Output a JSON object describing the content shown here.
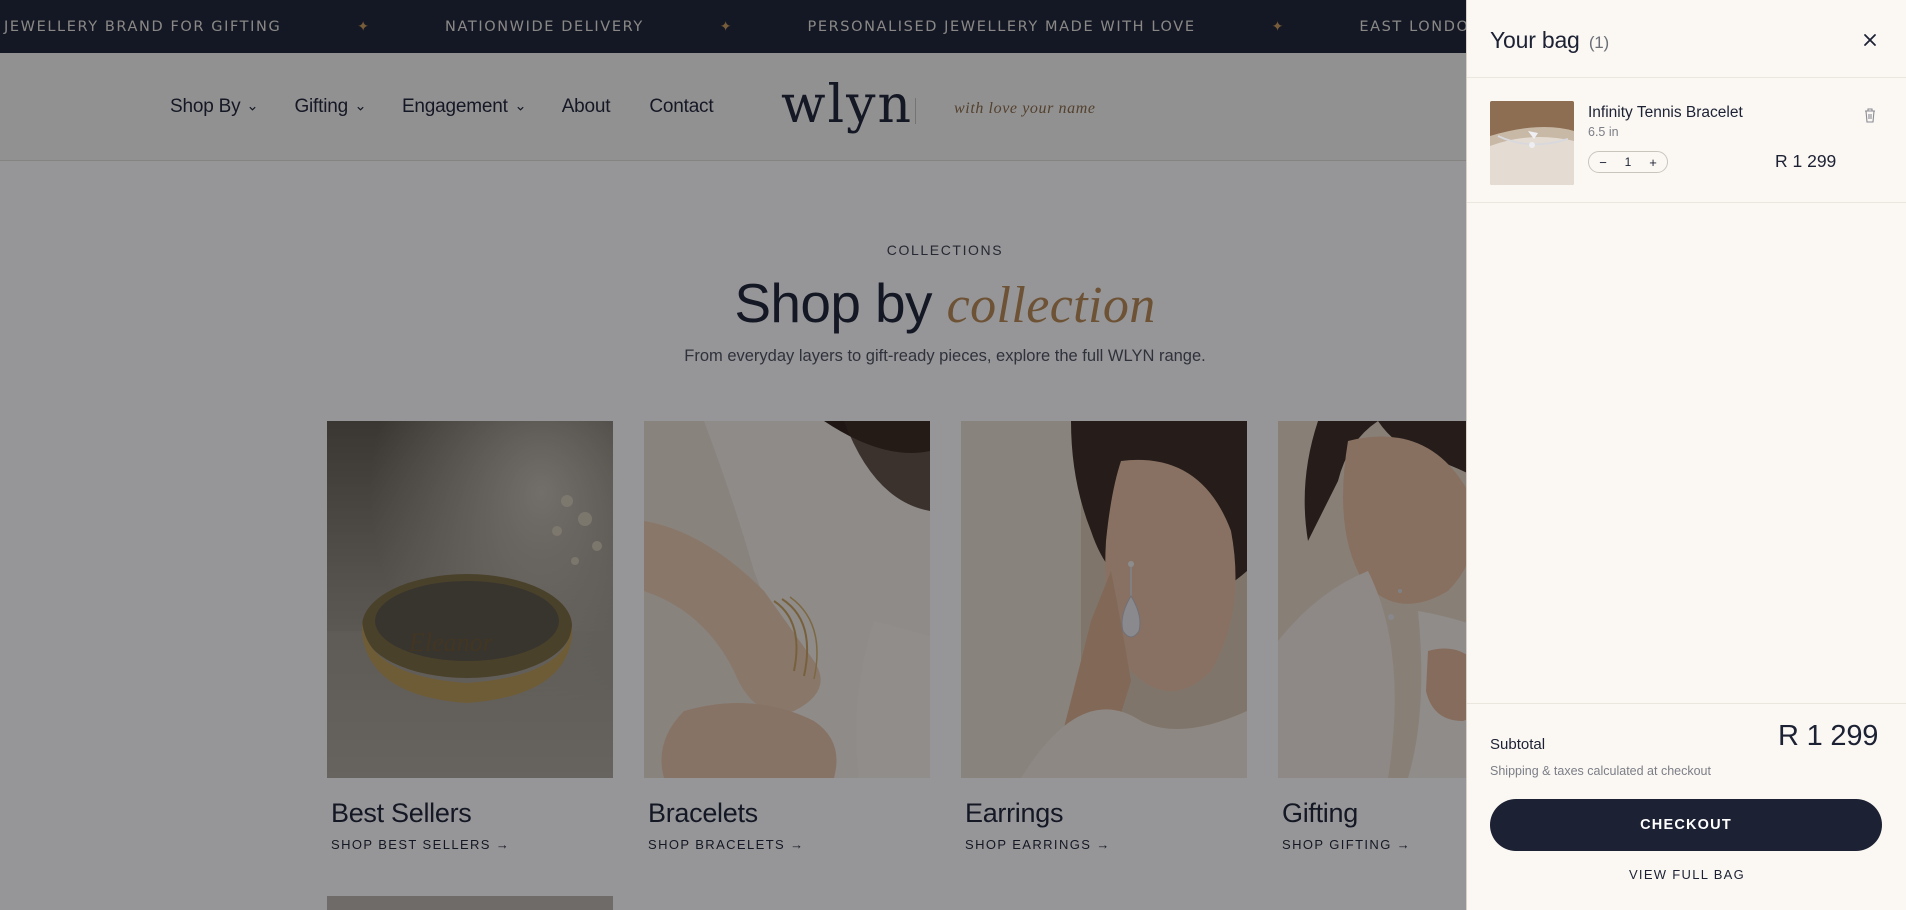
{
  "announcement": {
    "messages": [
      "JEWELLERY BRAND FOR GIFTING",
      "NATIONWIDE DELIVERY",
      "PERSONALISED JEWELLERY MADE WITH LOVE",
      "EAST LONDON LOCAL DELIVERY"
    ],
    "separator_icon": "sparkle-icon"
  },
  "header": {
    "nav": [
      {
        "label": "Shop By",
        "has_dropdown": true
      },
      {
        "label": "Gifting",
        "has_dropdown": true
      },
      {
        "label": "Engagement",
        "has_dropdown": true
      },
      {
        "label": "About",
        "has_dropdown": false
      },
      {
        "label": "Contact",
        "has_dropdown": false
      }
    ],
    "logo": "wlyn",
    "tagline": "with love your name"
  },
  "collections": {
    "eyebrow": "COLLECTIONS",
    "headline_main": "Shop by",
    "headline_accent": "collection",
    "subline": "From everyday layers to gift-ready pieces, explore the full WLYN range.",
    "cards": [
      {
        "title": "Best Sellers",
        "link": "SHOP BEST SELLERS →"
      },
      {
        "title": "Bracelets",
        "link": "SHOP BRACELETS →"
      },
      {
        "title": "Earrings",
        "link": "SHOP EARRINGS →"
      },
      {
        "title": "Gifting",
        "link": "SHOP GIFTING →"
      }
    ]
  },
  "bag": {
    "title": "Your bag",
    "count": "(1)",
    "close_icon": "close-icon",
    "items": [
      {
        "name": "Infinity Tennis Bracelet",
        "variant": "6.5 in",
        "quantity": "1",
        "price": "R 1 299",
        "remove_icon": "trash-icon"
      }
    ],
    "subtotal_label": "Subtotal",
    "subtotal_value": "R 1 299",
    "shipping_note": "Shipping & taxes calculated at checkout",
    "checkout_label": "CHECKOUT",
    "view_full_bag_label": "VIEW FULL BAG"
  },
  "colors": {
    "navy": "#1c2133",
    "gold_accent": "#b78852",
    "drawer_bg": "#fbf8f4",
    "header_bg": "#f8f7f5"
  }
}
